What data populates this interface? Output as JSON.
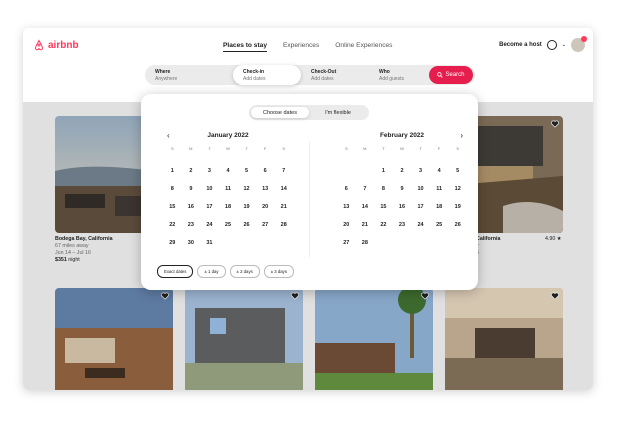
{
  "brand": {
    "name": "airbnb",
    "color": "#ff385c"
  },
  "nav": {
    "tabs": [
      "Places to stay",
      "Experiences",
      "Online Experiences"
    ],
    "host_link": "Become a host"
  },
  "search": {
    "where_label": "Where",
    "where_value": "Anywhere",
    "checkin_label": "Check-in",
    "checkin_value": "Add dates",
    "checkout_label": "Check-Out",
    "checkout_value": "Add dates",
    "who_label": "Who",
    "who_value": "Add guests",
    "button_label": "Search",
    "button_color": "#e61e4d"
  },
  "picker": {
    "toggle": [
      "Choose dates",
      "I'm flexible"
    ],
    "weekdays": [
      "S",
      "M",
      "T",
      "W",
      "T",
      "F",
      "S"
    ],
    "months": [
      {
        "title": "January 2022",
        "offset": 0,
        "days": 31
      },
      {
        "title": "February 2022",
        "offset": 2,
        "days": 28
      }
    ],
    "chips": [
      "Exact dates",
      "± 1 day",
      "± 2 days",
      "± 3 days"
    ]
  },
  "listings": [
    {
      "location": "Bodega Bay, California",
      "distance": "67 miles away",
      "dates": "Jun 14 – Jul 16",
      "price": "$351",
      "price_unit": " night"
    },
    {
      "location": "California",
      "rating": "4.90 ★",
      "distance_fragment": "y",
      "dates_fragment": "6"
    }
  ],
  "icons": [
    "logo-icon",
    "globe-icon",
    "chevron-down-icon",
    "avatar-icon",
    "search-icon",
    "heart-icon",
    "chevron-left-icon",
    "chevron-right-icon"
  ]
}
